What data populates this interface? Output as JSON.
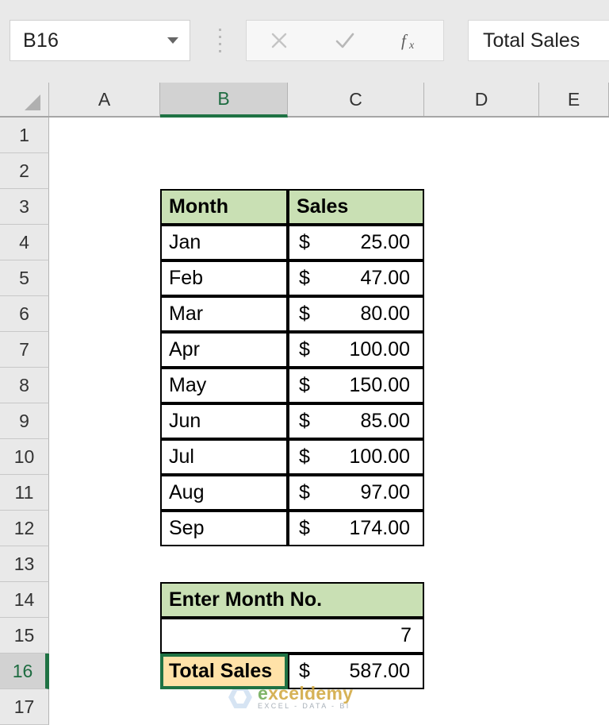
{
  "app": {
    "name_box_value": "B16",
    "formula_bar_value": "Total Sales",
    "cancel_icon": "close-icon",
    "enter_icon": "check-icon",
    "function_icon": "fx-icon"
  },
  "grid": {
    "column_headers": [
      "A",
      "B",
      "C",
      "D",
      "E"
    ],
    "selected_column": "B",
    "row_headers": [
      "1",
      "2",
      "3",
      "4",
      "5",
      "6",
      "7",
      "8",
      "9",
      "10",
      "11",
      "12",
      "13",
      "14",
      "15",
      "16",
      "17"
    ],
    "selected_row": "16"
  },
  "sales_table": {
    "headers": [
      "Month",
      "Sales"
    ],
    "rows": [
      {
        "month": "Jan",
        "currency": "$",
        "amount": "25.00"
      },
      {
        "month": "Feb",
        "currency": "$",
        "amount": "47.00"
      },
      {
        "month": "Mar",
        "currency": "$",
        "amount": "80.00"
      },
      {
        "month": "Apr",
        "currency": "$",
        "amount": "100.00"
      },
      {
        "month": "May",
        "currency": "$",
        "amount": "150.00"
      },
      {
        "month": "Jun",
        "currency": "$",
        "amount": "85.00"
      },
      {
        "month": "Jul",
        "currency": "$",
        "amount": "100.00"
      },
      {
        "month": "Aug",
        "currency": "$",
        "amount": "97.00"
      },
      {
        "month": "Sep",
        "currency": "$",
        "amount": "174.00"
      }
    ]
  },
  "input_section": {
    "prompt_label": "Enter Month No.",
    "month_number": "7",
    "total_label": "Total Sales",
    "total_currency": "$",
    "total_amount": "587.00"
  },
  "watermark": {
    "name_part1": "e",
    "name_part2": "xceldemy",
    "tagline": "EXCEL - DATA - BI"
  },
  "colors": {
    "header_fill": "#c9e0b4",
    "selection_green": "#1f7244",
    "selected_cell_fill": "#ffe2a8",
    "chrome_gray": "#e9e9e9"
  }
}
